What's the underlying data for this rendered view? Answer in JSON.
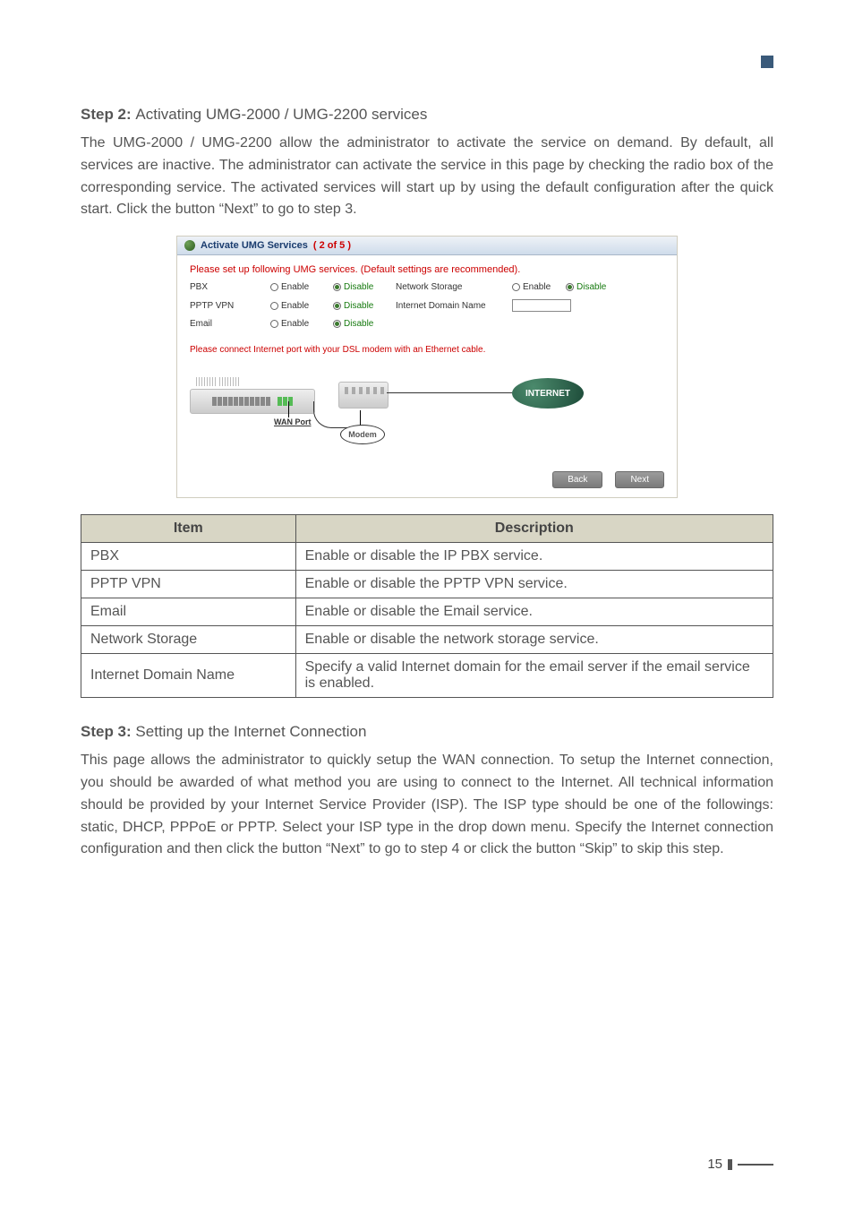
{
  "page_number": "15",
  "step2": {
    "label": "Step 2:",
    "title": "Activating UMG-2000 / UMG-2200 services",
    "paragraph": "The UMG-2000 / UMG-2200 allow the administrator to activate the service on demand. By default, all services are inactive. The administrator can activate the service in this page by checking the radio box of the corresponding service. The activated services will start up by using the default configuration after the quick start. Click the button “Next” to go to step 3."
  },
  "screenshot": {
    "window_title": "Activate UMG Services",
    "window_count": "( 2 of 5 )",
    "subtitle": "Please set up following UMG services. (Default settings are recommended).",
    "services": {
      "pbx": "PBX",
      "pptp": "PPTP VPN",
      "email": "Email",
      "netstorage": "Network Storage",
      "idn": "Internet Domain Name"
    },
    "radio": {
      "enable": "Enable",
      "disable": "Disable"
    },
    "connect_note": "Please connect Internet port with your DSL modem with an Ethernet cable.",
    "wan_label": "WAN Port",
    "modem_label": "Modem",
    "internet_label": "INTERNET",
    "buttons": {
      "back": "Back",
      "next": "Next"
    }
  },
  "def_table": {
    "headers": {
      "item": "Item",
      "desc": "Description"
    },
    "rows": [
      {
        "item": "PBX",
        "desc": "Enable or disable the IP PBX service."
      },
      {
        "item": "PPTP VPN",
        "desc": "Enable or disable the PPTP VPN service."
      },
      {
        "item": "Email",
        "desc": "Enable or disable the Email service."
      },
      {
        "item": "Network Storage",
        "desc": "Enable or disable the network storage service."
      },
      {
        "item": "Internet Domain Name",
        "desc": "Specify a valid Internet domain for the email server if the email service is enabled."
      }
    ]
  },
  "step3": {
    "label": "Step 3:",
    "title": "Setting up the Internet Connection",
    "paragraph": "This page allows the administrator to quickly setup the WAN connection. To setup the Internet connection, you should be awarded of what method you are using to connect to the Internet. All technical information should be provided by your Internet Service Provider (ISP). The ISP type should be one of the followings: static, DHCP, PPPoE or PPTP. Select your ISP type in the drop down menu. Specify the Internet connection configuration and then click the button “Next” to go to step 4 or click the button “Skip” to skip this step."
  }
}
